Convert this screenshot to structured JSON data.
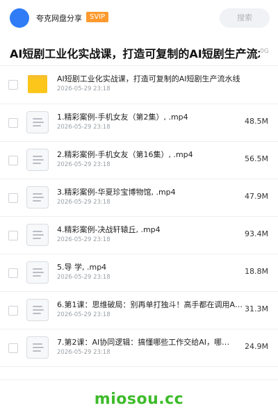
{
  "header": {
    "username": "夸克网盘分享",
    "badge": "SVIP",
    "search_placeholder": "搜索"
  },
  "title_bar": {
    "title": "AI短剧工业化实战课，打造可复制的AI短剧生产流水线",
    "size_fragment": "0G"
  },
  "files": [
    {
      "type": "folder",
      "icon": "folder-icon",
      "name": "AI短剧工业化实战课，打造可复制的AI短剧生产流水线",
      "date": "2026-05-29 23:18",
      "size": ""
    },
    {
      "type": "file",
      "icon": "document-icon",
      "name": "1.精彩案例-手机女友（第2集）, .mp4",
      "date": "2026-05-29 23:18",
      "size": "48.5M"
    },
    {
      "type": "file",
      "icon": "document-icon",
      "name": "2.精彩案例-手机女友（第16集）, .mp4",
      "date": "2026-05-29 23:18",
      "size": "56.5M"
    },
    {
      "type": "file",
      "icon": "document-icon",
      "name": "3.精彩案例-华夏珍宝博物馆, .mp4",
      "date": "2026-05-29 23:18",
      "size": "47.9M"
    },
    {
      "type": "file",
      "icon": "document-icon",
      "name": "4.精彩案例-决战轩辕丘, .mp4",
      "date": "2026-05-29 23:18",
      "size": "93.4M"
    },
    {
      "type": "file",
      "icon": "document-icon",
      "name": "5.导 学, .mp4",
      "date": "2026-05-29 23:18",
      "size": "18.8M"
    },
    {
      "type": "file",
      "icon": "document-icon",
      "name": "6.第1课：思维破局：别再单打独斗！高手都在调用A…",
      "date": "2026-05-29 23:18",
      "size": "31.3M"
    },
    {
      "type": "file",
      "icon": "document-icon",
      "name": "7.第2课：AI协同逻辑：搞懂哪些工作交给AI，哪…",
      "date": "2026-05-29 23:18",
      "size": "24.9M"
    }
  ],
  "watermark": "miosou.cc",
  "colors": {
    "accent": "#2f7cf6",
    "badge": "#ff9a2e",
    "folder": "#fcc61b",
    "watermark": "#3dbb2a"
  }
}
